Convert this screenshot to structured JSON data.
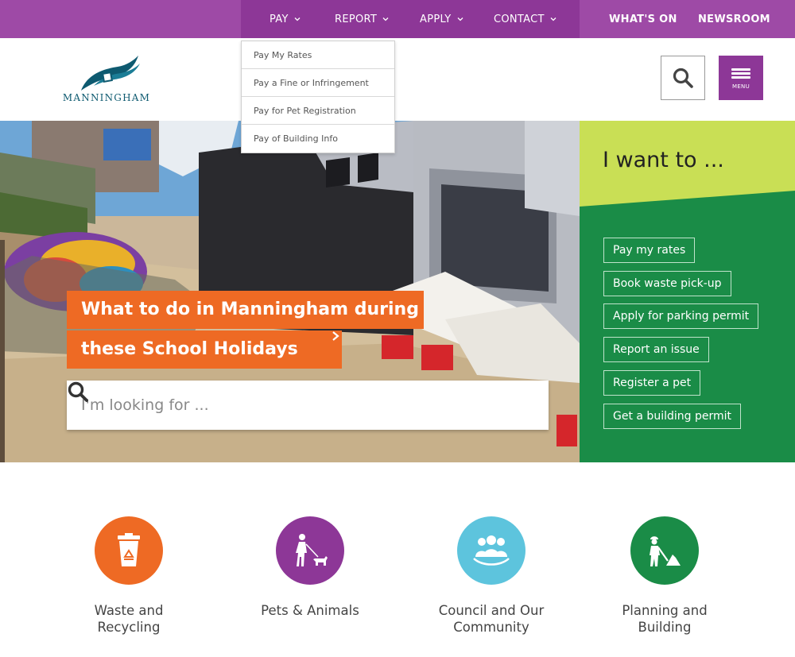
{
  "topnav": {
    "main": [
      {
        "label": "PAY"
      },
      {
        "label": "REPORT"
      },
      {
        "label": "APPLY"
      },
      {
        "label": "CONTACT"
      }
    ],
    "secondary": [
      {
        "label": "WHAT'S ON"
      },
      {
        "label": "NEWSROOM"
      }
    ]
  },
  "pay_dropdown": {
    "items": [
      {
        "label": "Pay My Rates"
      },
      {
        "label": "Pay a Fine or Infringement"
      },
      {
        "label": "Pay for Pet Registration"
      },
      {
        "label": "Pay of Building Info"
      }
    ]
  },
  "header": {
    "logo_text": "MANNINGHAM",
    "menu_label": "MENU"
  },
  "hero": {
    "promo_line1": "What to do in Manningham during",
    "promo_line2": "these School Holidays",
    "search_placeholder": "I'm looking for ..."
  },
  "i_want_to": {
    "title": "I want to ...",
    "links": [
      {
        "label": "Pay my rates"
      },
      {
        "label": "Book waste pick-up"
      },
      {
        "label": "Apply for parking permit"
      },
      {
        "label": "Report an issue"
      },
      {
        "label": "Register a pet"
      },
      {
        "label": "Get a building permit"
      }
    ]
  },
  "categories": [
    {
      "label": "Waste and Recycling",
      "icon": "recycling-bin-icon",
      "color": "#ee6a24"
    },
    {
      "label": "Pets & Animals",
      "icon": "dog-walker-icon",
      "color": "#8d3797"
    },
    {
      "label": "Council and Our Community",
      "icon": "community-group-icon",
      "color": "#5dc4dd"
    },
    {
      "label": "Planning and Building",
      "icon": "construction-worker-icon",
      "color": "#1a8c47"
    }
  ],
  "colors": {
    "purple": "#8d3797",
    "purple_light": "#9e4aa6",
    "orange": "#ee6a24",
    "green": "#1a8c47",
    "lime": "#c9df55"
  }
}
